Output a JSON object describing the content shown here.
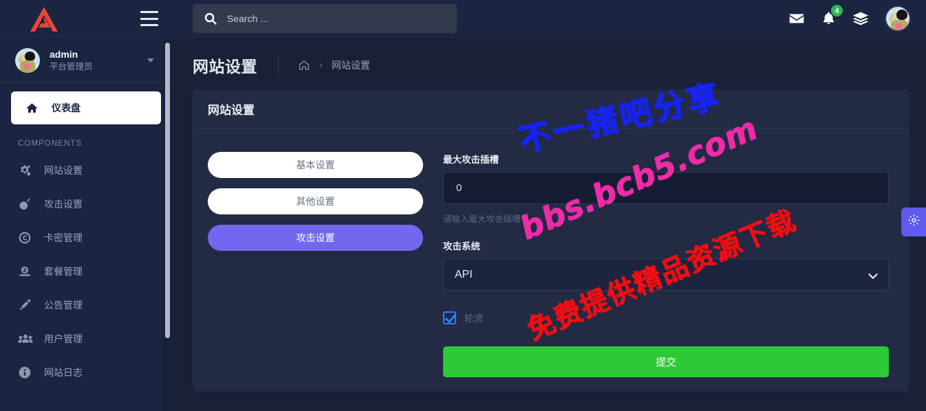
{
  "brand": {
    "logo_icon": "triangle-logo",
    "menu_icon": "hamburger-icon"
  },
  "sidebar": {
    "user": {
      "name": "admin",
      "role": "平台管理员",
      "avatar_icon": "user-avatar"
    },
    "active_item": {
      "label": "仪表盘",
      "icon": "home-icon"
    },
    "section_label": "COMPONENTS",
    "items": [
      {
        "label": "网站设置",
        "icon": "gears-icon"
      },
      {
        "label": "攻击设置",
        "icon": "bomb-icon"
      },
      {
        "label": "卡密管理",
        "icon": "copyright-icon"
      },
      {
        "label": "套餐管理",
        "icon": "money-icon"
      },
      {
        "label": "公告管理",
        "icon": "pen-icon"
      },
      {
        "label": "用户管理",
        "icon": "users-icon"
      },
      {
        "label": "网站日志",
        "icon": "info-icon"
      }
    ]
  },
  "topbar": {
    "search": {
      "placeholder": "Search ...",
      "value": "",
      "icon": "search-icon"
    },
    "mail_icon": "envelope-icon",
    "bell_icon": "bell-icon",
    "bell_badge": "4",
    "layers_icon": "layers-icon",
    "avatar_icon": "user-avatar"
  },
  "page": {
    "title": "网站设置",
    "breadcrumb": {
      "home_icon": "home-icon",
      "separator": "›",
      "current": "网站设置"
    }
  },
  "card": {
    "title": "网站设置",
    "tabs": [
      {
        "label": "基本设置",
        "active": false
      },
      {
        "label": "其他设置",
        "active": false
      },
      {
        "label": "攻击设置",
        "active": true
      }
    ],
    "form": {
      "slot_label": "最大攻击插槽",
      "slot_value": "0",
      "slot_help": "请输入最大攻击插槽",
      "system_label": "攻击系统",
      "system_value": "API",
      "system_options": [
        "API"
      ],
      "checkbox_label": "轮流",
      "checkbox_checked": true,
      "submit_label": "提交"
    }
  },
  "fab": {
    "icon": "gear-icon"
  },
  "watermarks": {
    "line1": "不一猪吧分享",
    "line2": "bbs.bcb5.com",
    "line3": "免费提供精品资源下载"
  },
  "colors": {
    "page_bg": "#1a2035",
    "sidebar_bg": "#1b2441",
    "card_bg": "#222a44",
    "accent_purple": "#7367ef",
    "submit_green": "#2dc937",
    "badge_green": "#35b457",
    "logo_red": "#e8453c",
    "wm_blue": "#1723ee",
    "wm_pink": "#ef2ba6",
    "wm_red": "#f20d12"
  }
}
